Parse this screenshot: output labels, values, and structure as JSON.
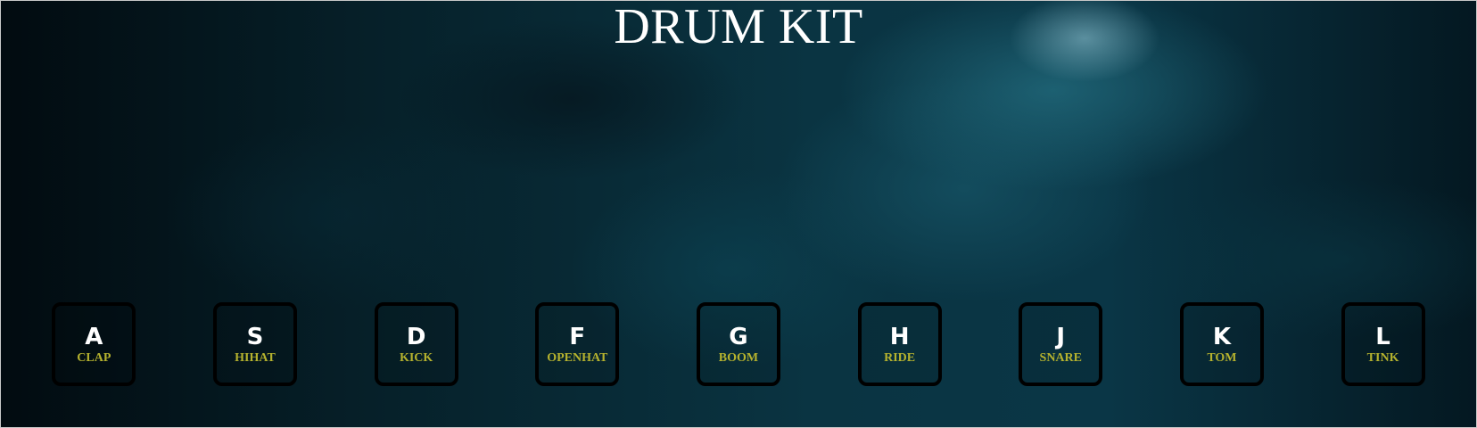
{
  "title": "DRUM KIT",
  "colors": {
    "letter": "#ffffff",
    "sound_label": "#b5b22e",
    "key_border": "#000000",
    "background": "#0a3442"
  },
  "keys": [
    {
      "letter": "A",
      "sound": "CLAP"
    },
    {
      "letter": "S",
      "sound": "HIHAT"
    },
    {
      "letter": "D",
      "sound": "KICK"
    },
    {
      "letter": "F",
      "sound": "OPENHAT"
    },
    {
      "letter": "G",
      "sound": "BOOM"
    },
    {
      "letter": "H",
      "sound": "RIDE"
    },
    {
      "letter": "J",
      "sound": "SNARE"
    },
    {
      "letter": "K",
      "sound": "TOM"
    },
    {
      "letter": "L",
      "sound": "TINK"
    }
  ]
}
